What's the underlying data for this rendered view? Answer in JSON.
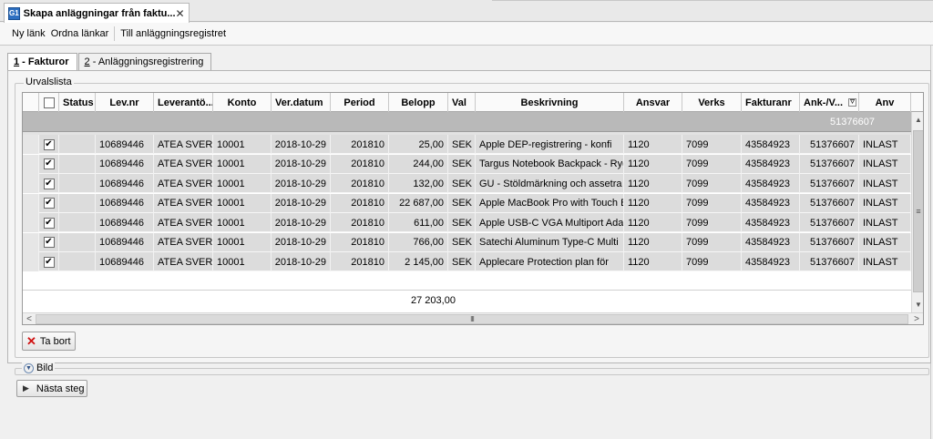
{
  "document_tab": {
    "icon_text": "G1",
    "title": "Skapa anläggningar från faktu...",
    "close_glyph": "✕"
  },
  "toolbar": {
    "items": [
      "Ny länk",
      "Ordna länkar",
      "Till anläggningsregistret"
    ]
  },
  "page_tabs": [
    {
      "num": "1",
      "label": " - Fakturor"
    },
    {
      "num": "2",
      "label": " - Anläggningsregistrering"
    }
  ],
  "selection_group": {
    "label": "Urvalslista"
  },
  "grid": {
    "columns": [
      "",
      "Status",
      "Lev.nr",
      "Leverantö...",
      "Konto",
      "Ver.datum",
      "Period",
      "Belopp",
      "Val",
      "Beskrivning",
      "Ansvar",
      "Verks",
      "Fakturanr",
      "Ank-/V...",
      "Anv"
    ],
    "filter_value": "51376607",
    "rows": [
      {
        "checked": "✔",
        "levnr": "10689446",
        "leverantor": "ATEA SVERI",
        "konto": "10001",
        "verdatum": "2018-10-29",
        "period": "201810",
        "belopp": "25,00",
        "val": "SEK",
        "beskrivning": "Apple DEP-registrering - konfi",
        "ansvar": "1120",
        "verks": "7099",
        "fakturanr": "43584923",
        "ank": "51376607",
        "anv": "INLAST"
      },
      {
        "checked": "✔",
        "levnr": "10689446",
        "leverantor": "ATEA SVERI",
        "konto": "10001",
        "verdatum": "2018-10-29",
        "period": "201810",
        "belopp": "244,00",
        "val": "SEK",
        "beskrivning": "Targus Notebook Backpack - Ryg",
        "ansvar": "1120",
        "verks": "7099",
        "fakturanr": "43584923",
        "ank": "51376607",
        "anv": "INLAST"
      },
      {
        "checked": "✔",
        "levnr": "10689446",
        "leverantor": "ATEA SVERI",
        "konto": "10001",
        "verdatum": "2018-10-29",
        "period": "201810",
        "belopp": "132,00",
        "val": "SEK",
        "beskrivning": "GU - Stöldmärkning och assetra",
        "ansvar": "1120",
        "verks": "7099",
        "fakturanr": "43584923",
        "ank": "51376607",
        "anv": "INLAST"
      },
      {
        "checked": "✔",
        "levnr": "10689446",
        "leverantor": "ATEA SVERI",
        "konto": "10001",
        "verdatum": "2018-10-29",
        "period": "201810",
        "belopp": "22 687,00",
        "val": "SEK",
        "beskrivning": "Apple MacBook Pro with Touch B",
        "ansvar": "1120",
        "verks": "7099",
        "fakturanr": "43584923",
        "ank": "51376607",
        "anv": "INLAST"
      },
      {
        "checked": "✔",
        "levnr": "10689446",
        "leverantor": "ATEA SVERI",
        "konto": "10001",
        "verdatum": "2018-10-29",
        "period": "201810",
        "belopp": "611,00",
        "val": "SEK",
        "beskrivning": "Apple USB-C VGA Multiport Ada",
        "ansvar": "1120",
        "verks": "7099",
        "fakturanr": "43584923",
        "ank": "51376607",
        "anv": "INLAST"
      },
      {
        "checked": "✔",
        "levnr": "10689446",
        "leverantor": "ATEA SVERI",
        "konto": "10001",
        "verdatum": "2018-10-29",
        "period": "201810",
        "belopp": "766,00",
        "val": "SEK",
        "beskrivning": "Satechi Aluminum Type-C Multi",
        "ansvar": "1120",
        "verks": "7099",
        "fakturanr": "43584923",
        "ank": "51376607",
        "anv": "INLAST"
      },
      {
        "checked": "✔",
        "levnr": "10689446",
        "leverantor": "ATEA SVERI",
        "konto": "10001",
        "verdatum": "2018-10-29",
        "period": "201810",
        "belopp": "2 145,00",
        "val": "SEK",
        "beskrivning": "Applecare Protection plan för",
        "ansvar": "1120",
        "verks": "7099",
        "fakturanr": "43584923",
        "ank": "51376607",
        "anv": "INLAST"
      }
    ],
    "sum": "27 203,00"
  },
  "buttons": {
    "remove_icon": "✕",
    "remove_label": "Ta bort",
    "next_icon": "▶",
    "next_label": "Nästa steg"
  },
  "bild": {
    "label": "Bild",
    "expand_glyph": "▼"
  },
  "scrollbar_glyphs": {
    "up": "▲",
    "down": "▼",
    "left": "<",
    "right": ">",
    "vgrip": "≡",
    "hgrip": "III"
  }
}
